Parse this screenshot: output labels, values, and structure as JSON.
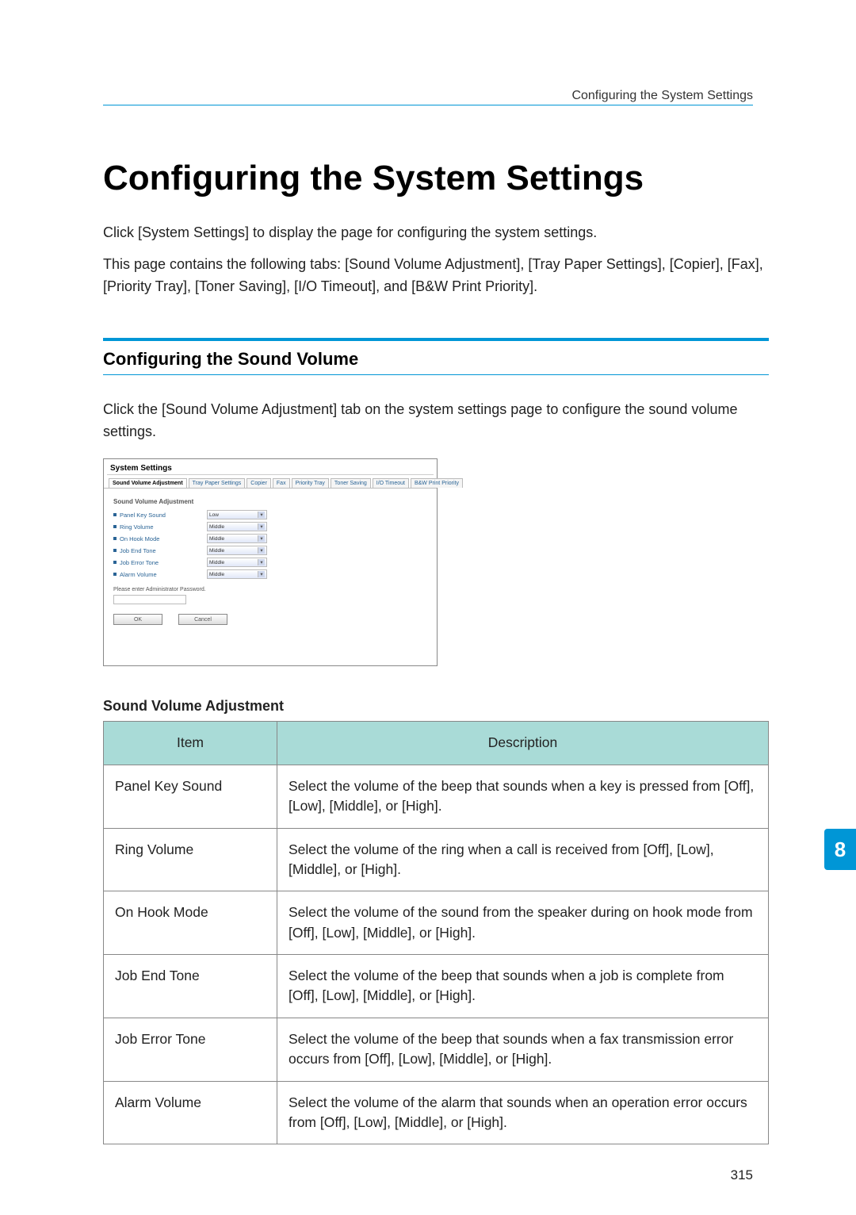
{
  "header": {
    "title": "Configuring the System Settings"
  },
  "h1": "Configuring the System Settings",
  "intro": [
    "Click [System Settings] to display the page for configuring the system settings.",
    "This page contains the following tabs: [Sound Volume Adjustment], [Tray Paper Settings], [Copier], [Fax], [Priority Tray], [Toner Saving], [I/O Timeout], and [B&W Print Priority]."
  ],
  "section": {
    "title": "Configuring the Sound Volume",
    "body": "Click the [Sound Volume Adjustment] tab on the system settings page to configure the sound volume settings."
  },
  "embed": {
    "title": "System Settings",
    "tabs": [
      "Sound Volume Adjustment",
      "Tray Paper Settings",
      "Copier",
      "Fax",
      "Priority Tray",
      "Toner Saving",
      "I/O Timeout",
      "B&W Print Priority"
    ],
    "group": "Sound Volume Adjustment",
    "rows": [
      {
        "label": "Panel Key Sound",
        "value": "Low"
      },
      {
        "label": "Ring Volume",
        "value": "Middle"
      },
      {
        "label": "On Hook Mode",
        "value": "Middle"
      },
      {
        "label": "Job End Tone",
        "value": "Middle"
      },
      {
        "label": "Job Error Tone",
        "value": "Middle"
      },
      {
        "label": "Alarm Volume",
        "value": "Middle"
      }
    ],
    "note": "Please enter Administrator Password.",
    "ok": "OK",
    "cancel": "Cancel"
  },
  "table": {
    "caption": "Sound Volume Adjustment",
    "head": {
      "item": "Item",
      "desc": "Description"
    },
    "rows": [
      {
        "item": "Panel Key Sound",
        "desc": "Select the volume of the beep that sounds when a key is pressed from [Off], [Low], [Middle], or [High]."
      },
      {
        "item": "Ring Volume",
        "desc": "Select the volume of the ring when a call is received from [Off], [Low], [Middle], or [High]."
      },
      {
        "item": "On Hook Mode",
        "desc": "Select the volume of the sound from the speaker during on hook mode from [Off], [Low], [Middle], or [High]."
      },
      {
        "item": "Job End Tone",
        "desc": "Select the volume of the beep that sounds when a job is complete from [Off], [Low], [Middle], or [High]."
      },
      {
        "item": "Job Error Tone",
        "desc": "Select the volume of the beep that sounds when a fax transmission error occurs from [Off], [Low], [Middle], or [High]."
      },
      {
        "item": "Alarm Volume",
        "desc": "Select the volume of the alarm that sounds when an operation error occurs from [Off], [Low], [Middle], or [High]."
      }
    ]
  },
  "chapter": "8",
  "page_number": "315"
}
